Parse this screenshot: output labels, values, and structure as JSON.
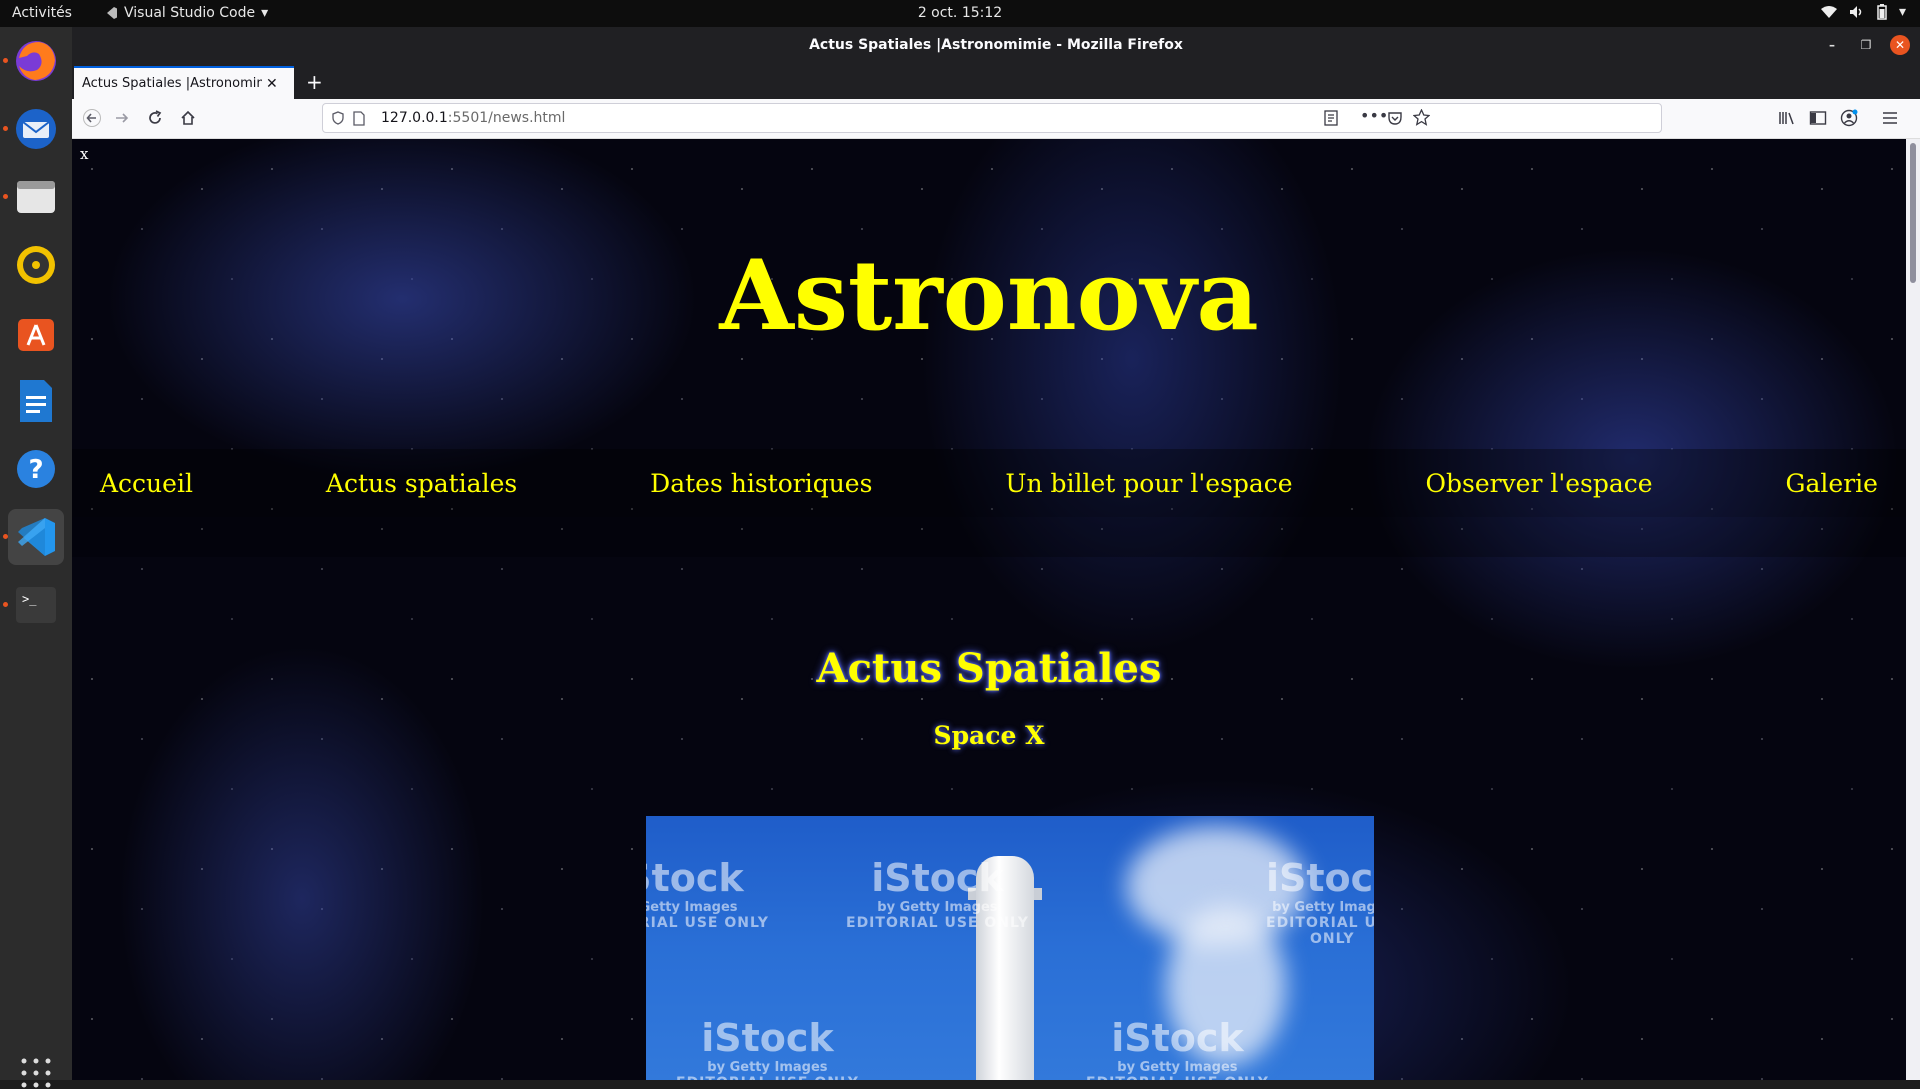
{
  "system": {
    "activities": "Activités",
    "app_menu": "Visual Studio Code",
    "clock": "2 oct.  15:12"
  },
  "dock": {
    "items": [
      "firefox-icon",
      "thunderbird-icon",
      "files-icon",
      "rhythmbox-icon",
      "software-icon",
      "writer-icon",
      "help-icon",
      "vscode-icon",
      "terminal-icon"
    ]
  },
  "browser": {
    "window_title": "Actus Spatiales |Astronomimie - Mozilla Firefox",
    "tab_title": "Actus Spatiales |Astronomimie",
    "url_host": "127.0.0.1",
    "url_rest": ":5501/news.html"
  },
  "page": {
    "close_label": "x",
    "site_title": "Astronova",
    "nav": [
      "Accueil",
      "Actus spatiales",
      "Dates historiques",
      "Un billet pour l'espace",
      "Observer l'espace",
      "Galerie"
    ],
    "section_title": "Actus Spatiales",
    "subsection_title": "Space X",
    "image": {
      "watermark_brand": "iStock",
      "watermark_by": "by Getty Images",
      "watermark_editorial": "EDITORIAL USE ONLY"
    }
  },
  "colors": {
    "accent_yellow": "#ffff00",
    "tab_accent": "#0060df",
    "ubuntu_orange": "#e95420"
  }
}
